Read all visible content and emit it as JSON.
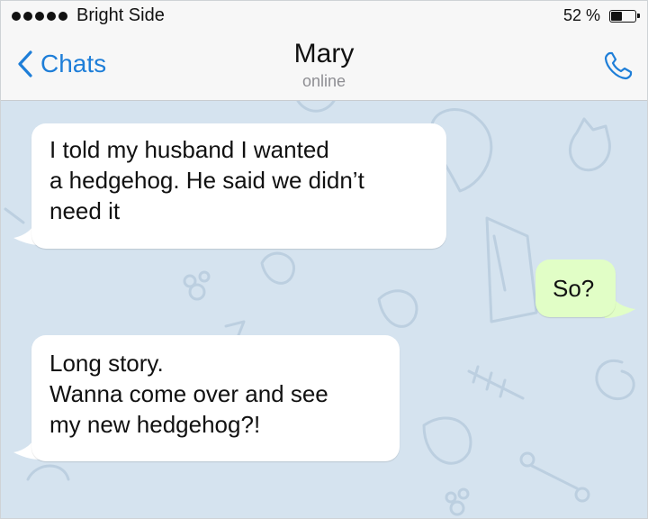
{
  "status_bar": {
    "carrier": "Bright Side",
    "battery_percent": "52 %",
    "battery_level": 0.52
  },
  "nav": {
    "back_label": "Chats",
    "title": "Mary",
    "subtitle": "online",
    "icons": {
      "back": "chevron-left-icon",
      "call": "phone-icon"
    }
  },
  "messages": [
    {
      "direction": "incoming",
      "text": "I told my husband I wanted\na hedgehog. He said we didn’t\nneed it"
    },
    {
      "direction": "outgoing",
      "text": "So?"
    },
    {
      "direction": "incoming",
      "text": "Long story.\nWanna come over and see\nmy new hedgehog?!"
    }
  ],
  "colors": {
    "accent": "#1e7ed8",
    "chat_background": "#d5e3ef",
    "incoming_bubble": "#ffffff",
    "outgoing_bubble": "#e1fec6"
  }
}
